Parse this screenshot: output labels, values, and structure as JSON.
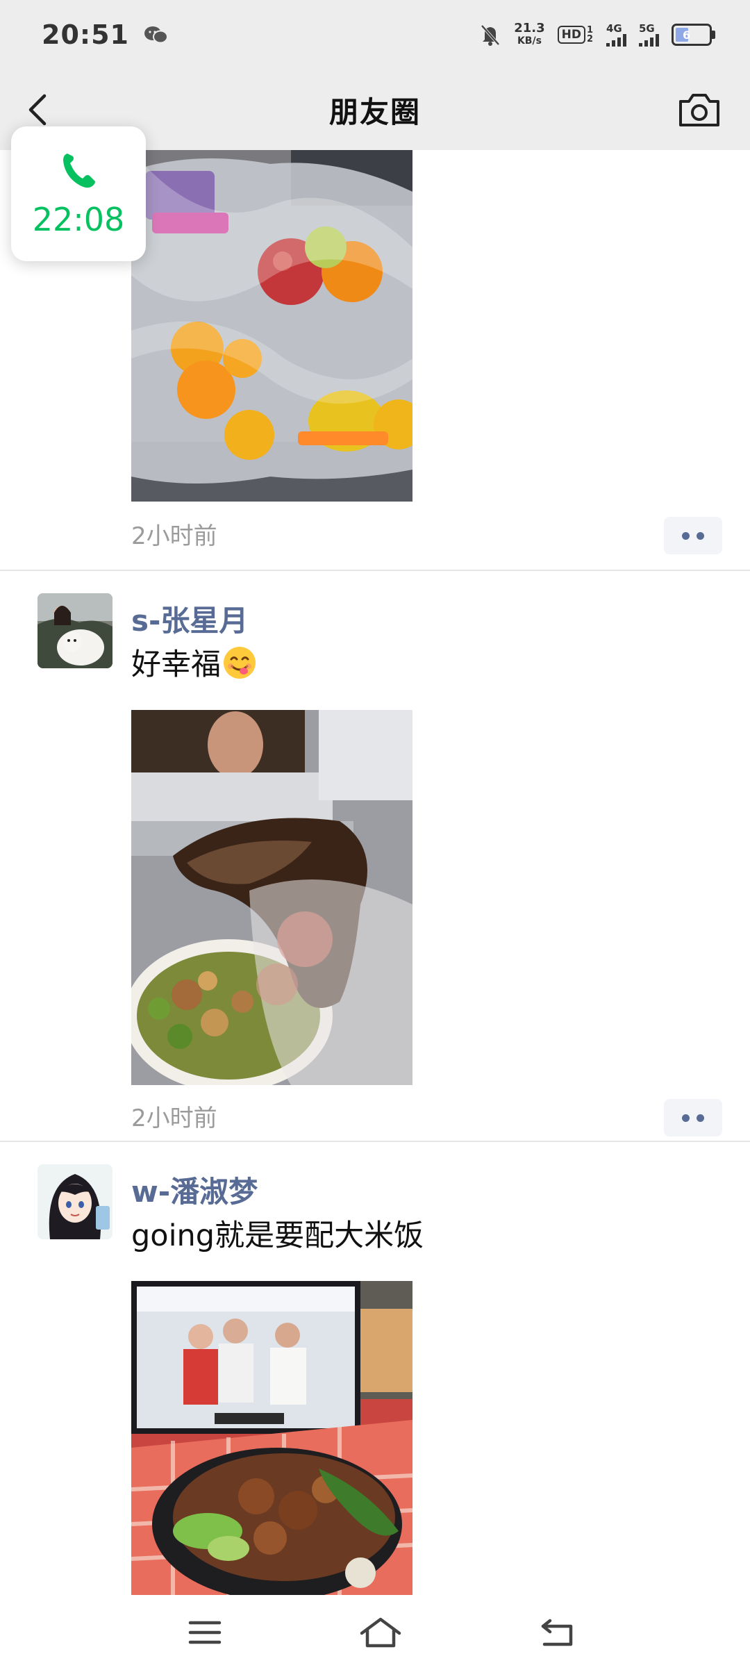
{
  "status_bar": {
    "time": "20:51",
    "net_speed_value": "21.3",
    "net_speed_unit": "KB/s",
    "hd_label": "HD",
    "hd_sub": "1 2",
    "signal1_label": "4G",
    "signal2_label": "5G",
    "battery_text": "6"
  },
  "nav": {
    "title": "朋友圈"
  },
  "call_float": {
    "duration": "22:08"
  },
  "posts": [
    {
      "name": "",
      "text": "",
      "time": "2小时前",
      "photo": "fruit-bag-photo"
    },
    {
      "name": "s-张星月",
      "text": "好幸福",
      "emoji": "yum-face-emoji",
      "time": "2小时前",
      "photo": "meat-salad-photo"
    },
    {
      "name": "w-潘淑梦",
      "text": "going就是要配大米饭",
      "photo": "rice-bowl-tv-photo"
    }
  ],
  "icons": {
    "back": "chevron-left-icon",
    "camera": "camera-icon",
    "call": "phone-icon",
    "more": "more-dots-icon",
    "menu": "menu-icon",
    "home": "home-icon",
    "return": "back-arrow-icon"
  },
  "colors": {
    "accent_green": "#07c160",
    "name_blue": "#576b95",
    "nav_bg": "#ededed",
    "time_gray": "#9b9b9b"
  }
}
